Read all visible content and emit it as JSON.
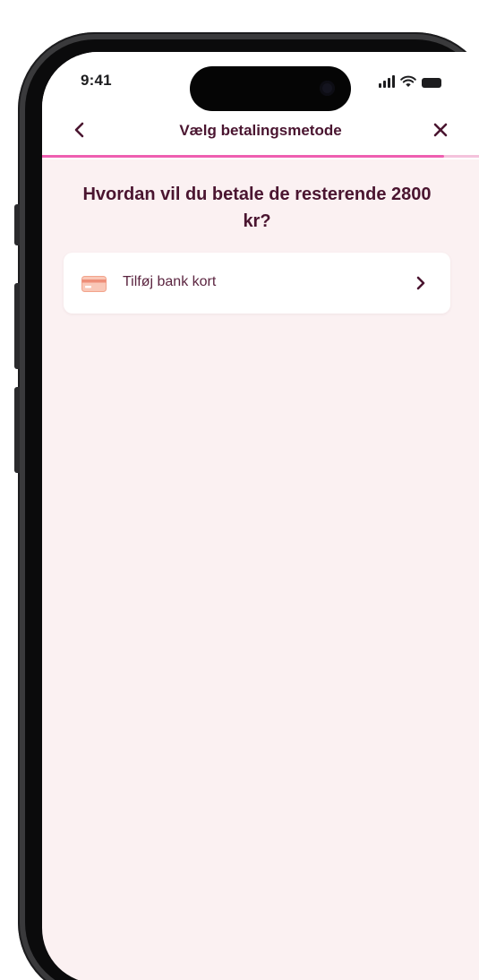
{
  "status_bar": {
    "time": "9:41"
  },
  "header": {
    "title": "Vælg betalingsmetode",
    "back_icon": "chevron-left-icon",
    "close_icon": "close-icon",
    "progress": 0.92
  },
  "main": {
    "question": "Hvordan vil du betale de resterende 2800 kr?",
    "options": [
      {
        "label": "Tilføj bank kort",
        "icon": "credit-card-icon"
      }
    ]
  },
  "colors": {
    "accent": "#ef5fb1",
    "accent_light": "#f4c3dc",
    "text": "#4a1530",
    "background": "#fbf1f2"
  }
}
